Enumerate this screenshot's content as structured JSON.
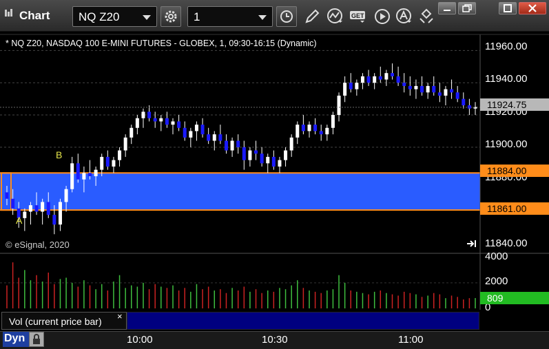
{
  "window": {
    "title": "Chart",
    "symbol": "NQ Z20",
    "interval": "1"
  },
  "toolbar": {
    "icons": [
      "settings-gear-icon",
      "clock-icon",
      "pencil-draw-icon",
      "indicator-wave-icon",
      "get-data-icon",
      "play-icon",
      "alert-a-icon",
      "move-arrows-icon"
    ],
    "window_buttons": [
      "minimize-icon",
      "restore-icon",
      "maximize-icon",
      "close-icon"
    ]
  },
  "chart": {
    "title": "* NQ Z20, NASDAQ 100 E-MINI FUTURES - GLOBEX, 1, 09:30-16:15 (Dynamic)",
    "copyright": "© eSignal, 2020",
    "label_a": "A",
    "label_b": "B",
    "colors": {
      "up": "#ffffff",
      "down": "#1a1aff",
      "zone": "#2a5cff",
      "zone_border": "#ff8c1a",
      "vol_up": "#3fbf3f",
      "vol_down": "#cc2222",
      "last_price_tag": "#b8b8b8",
      "vol_tag": "#22bb22"
    }
  },
  "price_axis": {
    "ticks": [
      "11960.00",
      "11940.00",
      "11920.00",
      "11900.00",
      "11880.00",
      "11840.00"
    ],
    "last_price": "11924.75",
    "upper_zone": "11884.00",
    "lower_zone": "11861.00"
  },
  "volume_axis": {
    "ticks": [
      "4000",
      "2000",
      "0"
    ],
    "last_volume": "809"
  },
  "study": {
    "label": "Vol (current price bar)",
    "close_glyph": "×"
  },
  "time_axis": {
    "mode": "Dyn",
    "ticks": [
      "10:00",
      "10:30",
      "11:00"
    ]
  },
  "chart_data": {
    "type": "candlestick",
    "title": "* NQ Z20, NASDAQ 100 E-MINI FUTURES - GLOBEX, 1, 09:30-16:15 (Dynamic)",
    "y_range": [
      11835,
      11970
    ],
    "zone": {
      "upper": 11884.0,
      "lower": 11861.0
    },
    "last_price": 11924.75,
    "candles": [
      [
        11872,
        11876,
        11864,
        11868
      ],
      [
        11868,
        11874,
        11858,
        11862
      ],
      [
        11862,
        11866,
        11850,
        11856
      ],
      [
        11856,
        11862,
        11848,
        11860
      ],
      [
        11860,
        11866,
        11852,
        11864
      ],
      [
        11864,
        11872,
        11858,
        11860
      ],
      [
        11860,
        11868,
        11852,
        11866
      ],
      [
        11866,
        11872,
        11856,
        11858
      ],
      [
        11858,
        11864,
        11846,
        11852
      ],
      [
        11852,
        11868,
        11848,
        11866
      ],
      [
        11866,
        11876,
        11860,
        11874
      ],
      [
        11874,
        11894,
        11872,
        11890
      ],
      [
        11890,
        11896,
        11878,
        11880
      ],
      [
        11880,
        11888,
        11872,
        11884
      ],
      [
        11884,
        11892,
        11880,
        11882
      ],
      [
        11882,
        11888,
        11876,
        11886
      ],
      [
        11886,
        11896,
        11882,
        11894
      ],
      [
        11894,
        11898,
        11886,
        11888
      ],
      [
        11888,
        11894,
        11884,
        11892
      ],
      [
        11892,
        11900,
        11888,
        11898
      ],
      [
        11898,
        11908,
        11894,
        11906
      ],
      [
        11906,
        11914,
        11902,
        11912
      ],
      [
        11912,
        11920,
        11908,
        11918
      ],
      [
        11918,
        11924,
        11912,
        11922
      ],
      [
        11922,
        11926,
        11916,
        11918
      ],
      [
        11918,
        11922,
        11912,
        11916
      ],
      [
        11916,
        11920,
        11910,
        11918
      ],
      [
        11918,
        11922,
        11912,
        11914
      ],
      [
        11914,
        11918,
        11908,
        11916
      ],
      [
        11916,
        11920,
        11910,
        11912
      ],
      [
        11912,
        11916,
        11904,
        11906
      ],
      [
        11906,
        11912,
        11900,
        11910
      ],
      [
        11910,
        11916,
        11904,
        11914
      ],
      [
        11914,
        11918,
        11906,
        11908
      ],
      [
        11908,
        11912,
        11902,
        11904
      ],
      [
        11904,
        11910,
        11898,
        11908
      ],
      [
        11908,
        11914,
        11902,
        11904
      ],
      [
        11904,
        11908,
        11896,
        11898
      ],
      [
        11898,
        11906,
        11894,
        11904
      ],
      [
        11904,
        11908,
        11896,
        11900
      ],
      [
        11900,
        11904,
        11886,
        11892
      ],
      [
        11892,
        11900,
        11888,
        11898
      ],
      [
        11898,
        11904,
        11892,
        11896
      ],
      [
        11896,
        11900,
        11888,
        11890
      ],
      [
        11890,
        11896,
        11884,
        11894
      ],
      [
        11894,
        11898,
        11886,
        11888
      ],
      [
        11888,
        11894,
        11884,
        11892
      ],
      [
        11892,
        11900,
        11888,
        11898
      ],
      [
        11898,
        11908,
        11894,
        11906
      ],
      [
        11906,
        11916,
        11902,
        11914
      ],
      [
        11914,
        11920,
        11908,
        11910
      ],
      [
        11910,
        11916,
        11906,
        11914
      ],
      [
        11914,
        11918,
        11908,
        11910
      ],
      [
        11910,
        11914,
        11904,
        11908
      ],
      [
        11908,
        11914,
        11904,
        11912
      ],
      [
        11912,
        11922,
        11908,
        11920
      ],
      [
        11920,
        11934,
        11916,
        11932
      ],
      [
        11932,
        11944,
        11928,
        11940
      ],
      [
        11940,
        11946,
        11934,
        11936
      ],
      [
        11936,
        11942,
        11932,
        11940
      ],
      [
        11940,
        11946,
        11936,
        11944
      ],
      [
        11944,
        11948,
        11938,
        11940
      ],
      [
        11940,
        11946,
        11936,
        11944
      ],
      [
        11944,
        11950,
        11940,
        11942
      ],
      [
        11942,
        11948,
        11938,
        11946
      ],
      [
        11946,
        11952,
        11942,
        11944
      ],
      [
        11944,
        11950,
        11938,
        11940
      ],
      [
        11940,
        11946,
        11934,
        11938
      ],
      [
        11938,
        11944,
        11932,
        11936
      ],
      [
        11936,
        11942,
        11930,
        11938
      ],
      [
        11938,
        11944,
        11932,
        11934
      ],
      [
        11934,
        11940,
        11930,
        11938
      ],
      [
        11938,
        11944,
        11932,
        11934
      ],
      [
        11934,
        11940,
        11928,
        11932
      ],
      [
        11932,
        11938,
        11926,
        11936
      ],
      [
        11936,
        11942,
        11930,
        11934
      ],
      [
        11934,
        11938,
        11928,
        11930
      ],
      [
        11930,
        11934,
        11924,
        11926
      ],
      [
        11926,
        11930,
        11920,
        11924
      ],
      [
        11924,
        11928,
        11920,
        11925
      ]
    ],
    "volume": [
      1800,
      3600,
      2400,
      3000,
      2200,
      2600,
      2100,
      2800,
      1900,
      2300,
      2400,
      2000,
      1700,
      2200,
      1800,
      1500,
      1900,
      1400,
      2100,
      2600,
      1600,
      1800,
      1700,
      2000,
      1500,
      1900,
      1700,
      1600,
      1800,
      1400,
      1600,
      1300,
      1900,
      1500,
      1700,
      1400,
      1500,
      1200,
      1600,
      1400,
      1700,
      1300,
      1500,
      1200,
      1400,
      1300,
      1600,
      1500,
      1800,
      2200,
      1600,
      1400,
      1300,
      1200,
      1400,
      1500,
      2600,
      2000,
      1400,
      1300,
      1200,
      1100,
      1300,
      1400,
      1200,
      1100,
      1000,
      1300,
      1200,
      1100,
      900,
      1000,
      1200,
      1100,
      800,
      1000,
      900,
      700,
      800,
      809
    ],
    "volume_ylim": [
      0,
      4200
    ]
  }
}
